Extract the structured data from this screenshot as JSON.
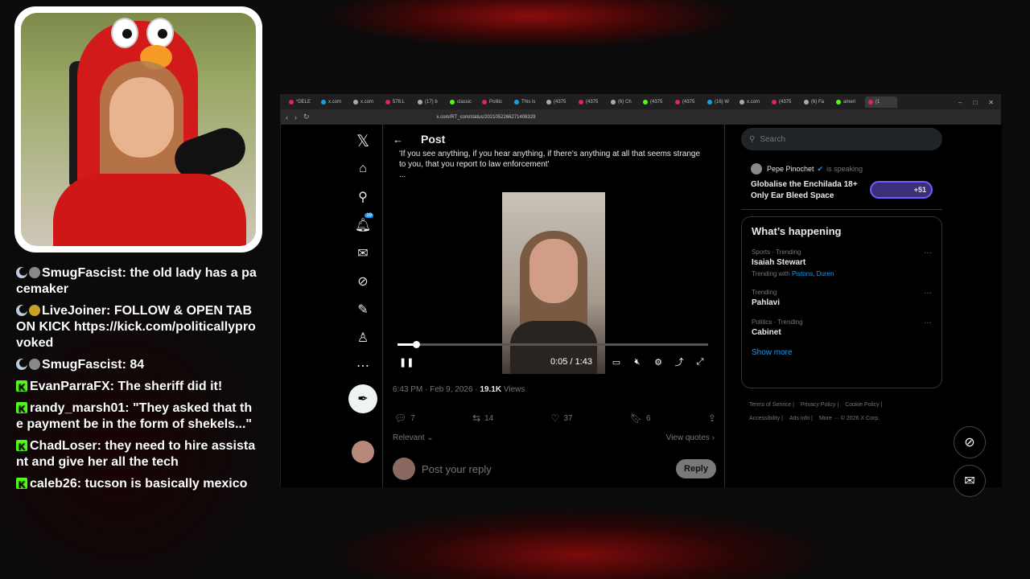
{
  "chat": [
    {
      "badges": [
        "moon",
        "gray"
      ],
      "user": "SmugFascist",
      "text": "the old lady has a pacemaker"
    },
    {
      "badges": [
        "moon",
        "gold"
      ],
      "user": "LiveJoiner",
      "text": "FOLLOW & OPEN TAB ON KICK https://kick.com/politicallyprovoked"
    },
    {
      "badges": [
        "moon",
        "gray"
      ],
      "user": "SmugFascist",
      "text": "84"
    },
    {
      "badges": [
        "kick"
      ],
      "user": "EvanParraFX",
      "text": "The sheriff did it!"
    },
    {
      "badges": [
        "kick"
      ],
      "user": "randy_marsh01",
      "text": "\"They asked that the payment be in the form of shekels...\""
    },
    {
      "badges": [
        "kick"
      ],
      "user": "ChadLoser",
      "text": "they need to hire assistant and give her all the tech"
    },
    {
      "badges": [
        "kick"
      ],
      "user": "caleb26",
      "text": "tucson is basically mexico"
    }
  ],
  "browser": {
    "tabs": [
      "*DELE",
      "x.com",
      "x.com",
      "578.L",
      "(17) b",
      "classic",
      "Politic",
      "This is",
      "(4375",
      "(4375",
      "(6) Ch",
      "(4375",
      "(4375",
      "(16) W",
      "x.com",
      "(4375",
      "(6) Fa",
      "ameri",
      "(1"
    ],
    "url": "x.com/RT_com/status/2021052266271408329"
  },
  "x": {
    "notif_count": "19",
    "post_title": "Post",
    "quote_text": "'If you see anything, if you hear anything, if there's anything at all that seems strange to you, that you report to law enforcement'",
    "quote_more": "...",
    "video": {
      "time": "0:05 / 1:43",
      "progress": 0.06
    },
    "meta": {
      "datetime": "6:43 PM · Feb 9, 2026 · ",
      "views": "19.1K",
      "views_label": " Views"
    },
    "actions": {
      "replies": "7",
      "reposts": "14",
      "likes": "37",
      "bookmarks": "6"
    },
    "relevant": "Relevant ⌄",
    "view_quotes": "View quotes ›",
    "reply_placeholder": "Post your reply",
    "reply_button": "Reply",
    "search_placeholder": "Search",
    "space": {
      "host": "Pepe Pinochet",
      "speaking": "is speaking",
      "title": "Globalise the Enchilada 18+ Only Ear Bleed Space",
      "count": "+51"
    },
    "happening_title": "What’s happening",
    "trends": [
      {
        "cat": "Sports · Trending",
        "name": "Isaiah Stewart",
        "with_label": "Trending with ",
        "with": "Pistons, Duren"
      },
      {
        "cat": "Trending",
        "name": "Pahlavi",
        "with_label": "",
        "with": ""
      },
      {
        "cat": "Politics · Trending",
        "name": "Cabinet",
        "with_label": "",
        "with": ""
      }
    ],
    "show_more": "Show more",
    "footer": [
      "Terms of Service |",
      "Privacy Policy |",
      "Cookie Policy |",
      "Accessibility |",
      "Ads info |",
      "More ··· © 2026 X Corp."
    ]
  }
}
